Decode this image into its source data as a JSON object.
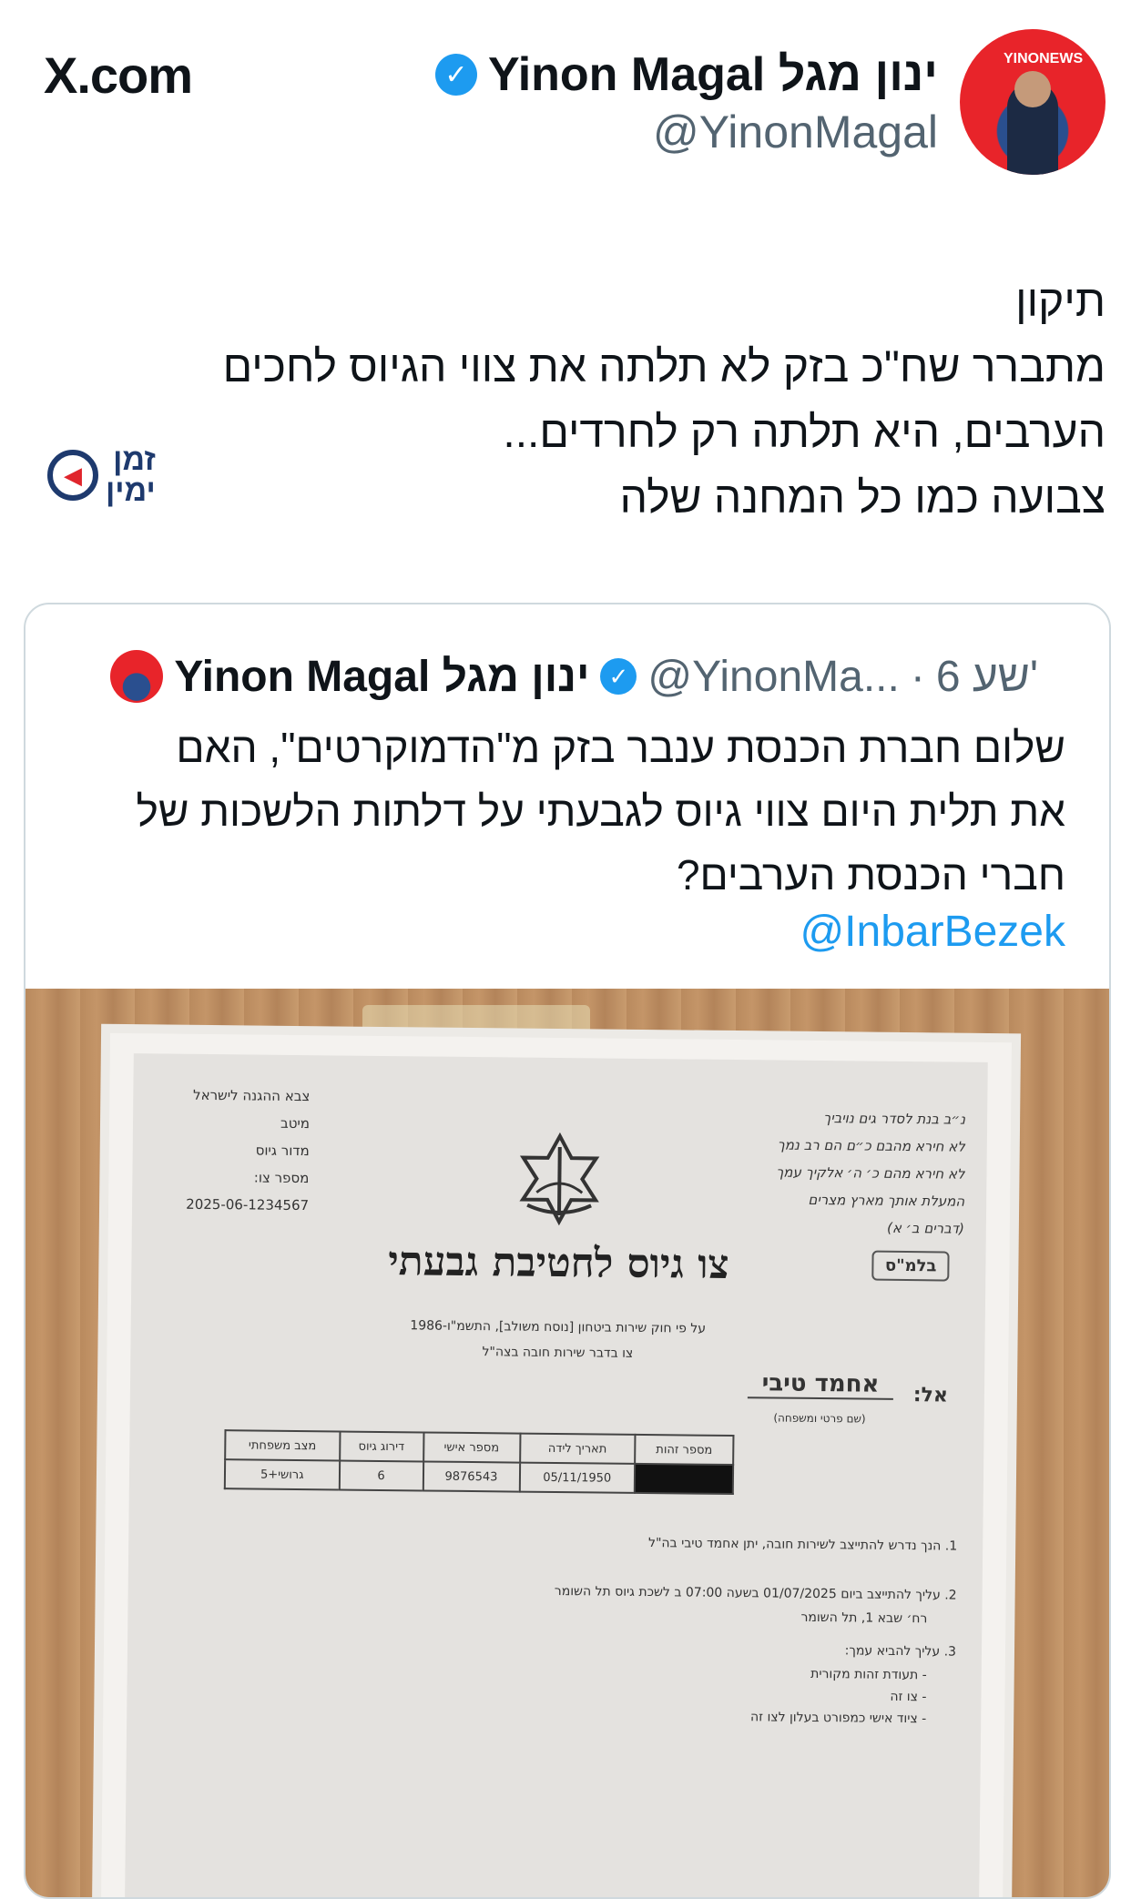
{
  "header": {
    "site": "X.com",
    "display_name": "Yinon Magal ינון מגל",
    "handle": "@YinonMagal",
    "avatar_badge": "YINONEWS"
  },
  "tweet": {
    "lines": [
      "תיקון",
      "מתברר שח\"כ בזק לא תלתה את צווי הגיוס לחכים",
      "הערבים, היא תלתה רק לחרדים...",
      "צבועה כמו כל המחנה שלה"
    ]
  },
  "watermark": {
    "line1": "זמן",
    "line2": "ימין"
  },
  "quoted": {
    "display_name": "Yinon Magal ינון מגל",
    "handle": "@YinonMa...",
    "separator": "·",
    "time": "6 שע'",
    "text_lines": [
      "שלום חברת הכנסת ענבר בזק מ\"הדמוקרטים\", האם",
      "את תלית היום צווי גיוס לגבעתי על דלתות הלשכות של",
      "חברי הכנסת הערבים?"
    ],
    "mention": "@InbarBezek"
  },
  "document": {
    "right_block": [
      "נ״ב בנת לסדר גים נויביך",
      "לא חירא מהבם כ״ם הם רב נמך",
      "לא חירא מהם כ׳ ה׳ אלקיך עמך",
      "המעלת אותך מארץ מצרים",
      "(דברים ב׳ א)"
    ],
    "left_block": [
      "צבא ההגנה לישראל",
      "מיטב",
      "מדור גיוס",
      "מספר צו:",
      "2025-06-1234567"
    ],
    "title": "צו גיוס לחטיבת גבעתי",
    "stamp": "בלמ\"ס",
    "sub_lines": [
      "על פי חוק שירות ביטחון [נוסח משולב], התשמ\"ו-1986",
      "צו בדבר שירות חובה בצה\"ל"
    ],
    "to_label": "אל:",
    "to_name": "אחמד טיבי",
    "to_caption": "(שם פרטי ומשפחה)",
    "table_headers": [
      "מספר זהות",
      "תאריך לידה",
      "מספר אישי",
      "דירוג גיוס",
      "מצב משפחתי"
    ],
    "table_values": [
      "",
      "05/11/1950",
      "9876543",
      "6",
      "גרושי+5"
    ],
    "item1": "1.   הנך נדרש להתייצב לשירות חובה, יתן אחמד טיבי בה\"ל",
    "item2": "2.   עליך להתייצב ביום  01/07/2025  בשעה  07:00  ב  לשכת גיוס תל השומר",
    "item2b": "רח׳ שבא 1, תל השומר",
    "item3": "3.   עליך להביא עמך:",
    "item3_list": [
      "- תעודת זהות מקורית",
      "- צו זה",
      "- ציוד אישי כמפורט בעלון לצו זה"
    ]
  }
}
